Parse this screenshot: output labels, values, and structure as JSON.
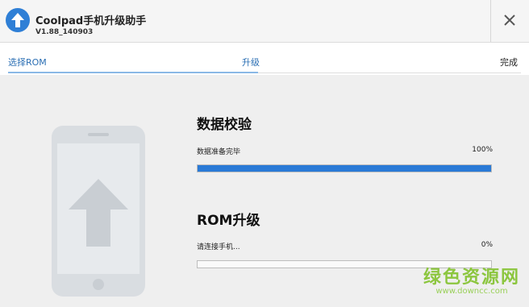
{
  "app": {
    "name": "Coolpad手机升级助手",
    "version": "V1.88_140903",
    "accent": "#2f7fd6"
  },
  "steps": [
    {
      "label": "选择ROM",
      "state": "done"
    },
    {
      "label": "升级",
      "state": "current"
    },
    {
      "label": "完成",
      "state": "pending"
    }
  ],
  "sections": [
    {
      "title": "数据校验",
      "status": "数据准备完毕",
      "percent_text": "100%",
      "progress": 1.0
    },
    {
      "title": "ROM升级",
      "status": "请连接手机...",
      "percent_text": "0%",
      "progress": 0.0
    }
  ],
  "icons": {
    "close": "close-icon",
    "logo": "upload-arrow-icon",
    "illustration": "phone-upload-icon"
  },
  "watermark": {
    "text": "绿色资源网",
    "url": "www.downcc.com"
  }
}
